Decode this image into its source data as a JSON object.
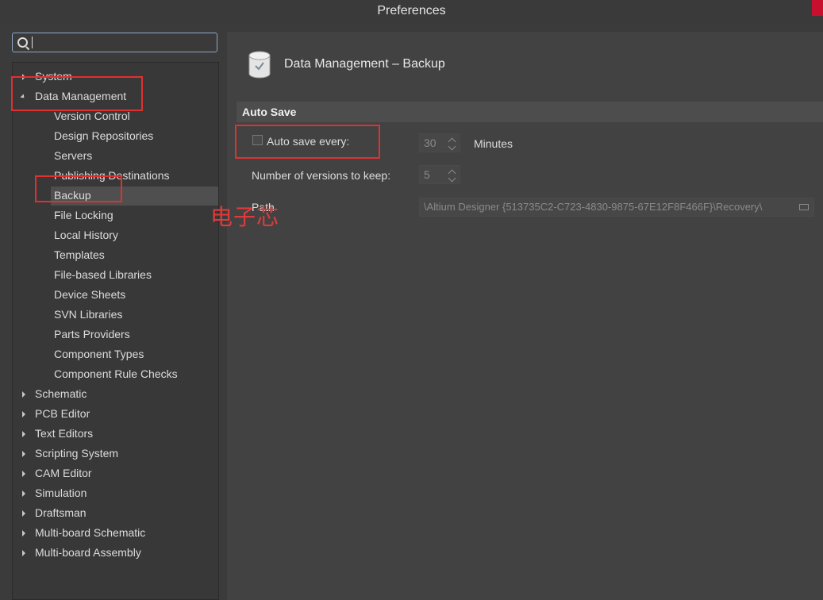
{
  "window": {
    "title": "Preferences"
  },
  "search": {
    "value": ""
  },
  "tree": {
    "items": [
      {
        "label": "System",
        "level": 0,
        "expander": "collapsed"
      },
      {
        "label": "Data Management",
        "level": 0,
        "expander": "expanded"
      },
      {
        "label": "Version Control",
        "level": 1
      },
      {
        "label": "Design Repositories",
        "level": 1
      },
      {
        "label": "Servers",
        "level": 1
      },
      {
        "label": "Publishing Destinations",
        "level": 1
      },
      {
        "label": "Backup",
        "level": 1,
        "selected": true
      },
      {
        "label": "File Locking",
        "level": 1
      },
      {
        "label": "Local History",
        "level": 1
      },
      {
        "label": "Templates",
        "level": 1
      },
      {
        "label": "File-based Libraries",
        "level": 1
      },
      {
        "label": "Device Sheets",
        "level": 1
      },
      {
        "label": "SVN Libraries",
        "level": 1
      },
      {
        "label": "Parts Providers",
        "level": 1
      },
      {
        "label": "Component Types",
        "level": 1
      },
      {
        "label": "Component Rule Checks",
        "level": 1
      },
      {
        "label": "Schematic",
        "level": 0,
        "expander": "collapsed"
      },
      {
        "label": "PCB Editor",
        "level": 0,
        "expander": "collapsed"
      },
      {
        "label": "Text Editors",
        "level": 0,
        "expander": "collapsed"
      },
      {
        "label": "Scripting System",
        "level": 0,
        "expander": "collapsed"
      },
      {
        "label": "CAM Editor",
        "level": 0,
        "expander": "collapsed"
      },
      {
        "label": "Simulation",
        "level": 0,
        "expander": "collapsed"
      },
      {
        "label": "Draftsman",
        "level": 0,
        "expander": "collapsed"
      },
      {
        "label": "Multi-board Schematic",
        "level": 0,
        "expander": "collapsed"
      },
      {
        "label": "Multi-board Assembly",
        "level": 0,
        "expander": "collapsed"
      }
    ]
  },
  "content": {
    "title": "Data Management – Backup",
    "section": "Auto Save",
    "auto_save": {
      "label": "Auto save every:",
      "checked": false,
      "value": "30",
      "unit": "Minutes"
    },
    "versions": {
      "label": "Number of versions to keep:",
      "value": "5"
    },
    "path": {
      "label": "Path",
      "value": "\\Altium Designer {513735C2-C723-4830-9875-67E12F8F466F}\\Recovery\\"
    }
  },
  "watermark": "电子芯",
  "colors": {
    "annotation": "#e03030",
    "background": "#3b3b3b",
    "panel": "#424242"
  }
}
